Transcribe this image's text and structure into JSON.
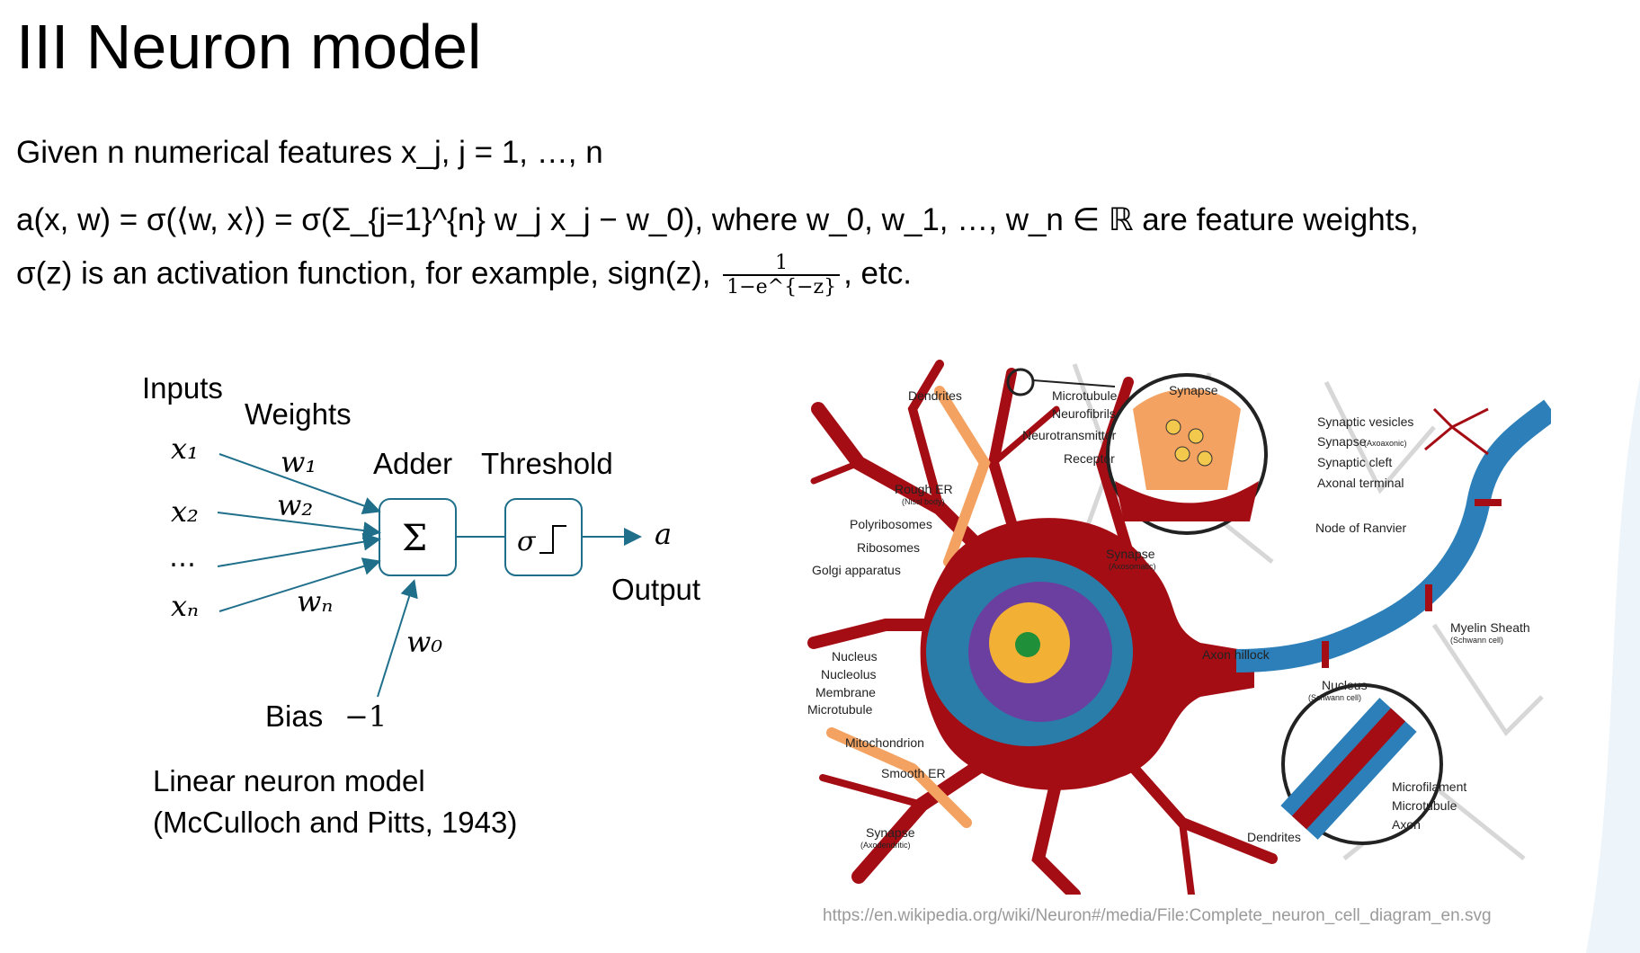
{
  "slide": {
    "title": "III Neuron model",
    "line1": "Given n numerical features x_j, j = 1, …, n",
    "line2": "a(x, w) = σ(⟨w, x⟩) = σ(Σ_{j=1}^{n} w_j x_j − w_0), where w_0, w_1, …, w_n ∈ ℝ are feature weights,",
    "line3_text": "σ(z) is an activation function, for example, sign(z),",
    "line3_frac_num": "1",
    "line3_frac_den": "1−e^{−z}",
    "line3_end": ", etc."
  },
  "diagram": {
    "inputs_label": "Inputs",
    "weights_label": "Weights",
    "adder_label": "Adder",
    "threshold_label": "Threshold",
    "output_label": "Output",
    "bias_label": "Bias",
    "bias_value": "−1",
    "x1": "x₁",
    "x2": "x₂",
    "dots": "…",
    "xn": "xₙ",
    "w1": "w₁",
    "w2": "w₂",
    "wn": "wₙ",
    "w0": "w₀",
    "sum_symbol": "Σ",
    "sigma_symbol": "σ",
    "output_symbol": "a",
    "accent_color": "#1f6f8b"
  },
  "caption": {
    "line1": "Linear neuron model",
    "line2": "(McCulloch and Pitts, 1943)"
  },
  "neuron_picture": {
    "labels": {
      "dendrites_top": "Dendrites",
      "rough_er": "Rough ER",
      "nissl": "(Nissl body)",
      "polyribosomes": "Polyribosomes",
      "ribosomes": "Ribosomes",
      "golgi": "Golgi apparatus",
      "nucleus": "Nucleus",
      "nucleolus": "Nucleolus",
      "membrane": "Membrane",
      "microtubule_left": "Microtubule",
      "mitochondrion": "Mitochondrion",
      "smooth_er": "Smooth ER",
      "synapse_axodendritic": "Synapse",
      "axodendritic": "(Axodendritic)",
      "microtubule_top": "Microtubule",
      "neurofibrils": "Neurofibrils",
      "neurotransmitter": "Neurotransmitter",
      "receptor": "Receptor",
      "synapse_circle": "Synapse",
      "synaptic_vesicles": "Synaptic vesicles",
      "synapse_axoaxonic": "Synapse",
      "axoaxonic": "(Axoaxonic)",
      "synaptic_cleft": "Synaptic cleft",
      "axonal_terminal": "Axonal terminal",
      "node_of_ranvier": "Node of Ranvier",
      "synapse_axosomatic": "Synapse",
      "axosomatic": "(Axosomatic)",
      "axon_hillock": "Axon hillock",
      "myelin_sheath": "Myelin Sheath",
      "schwann_cell": "(Schwann cell)",
      "nucleus_schwann": "Nucleus",
      "schwann_cell2": "(Schwann cell)",
      "microfilament": "Microfilament",
      "microtubule_right": "Microtubule",
      "axon": "Axon",
      "dendrites_bottom": "Dendrites"
    },
    "credit": "https://en.wikipedia.org/wiki/Neuron#/media/File:Complete_neuron_cell_diagram_en.svg"
  }
}
